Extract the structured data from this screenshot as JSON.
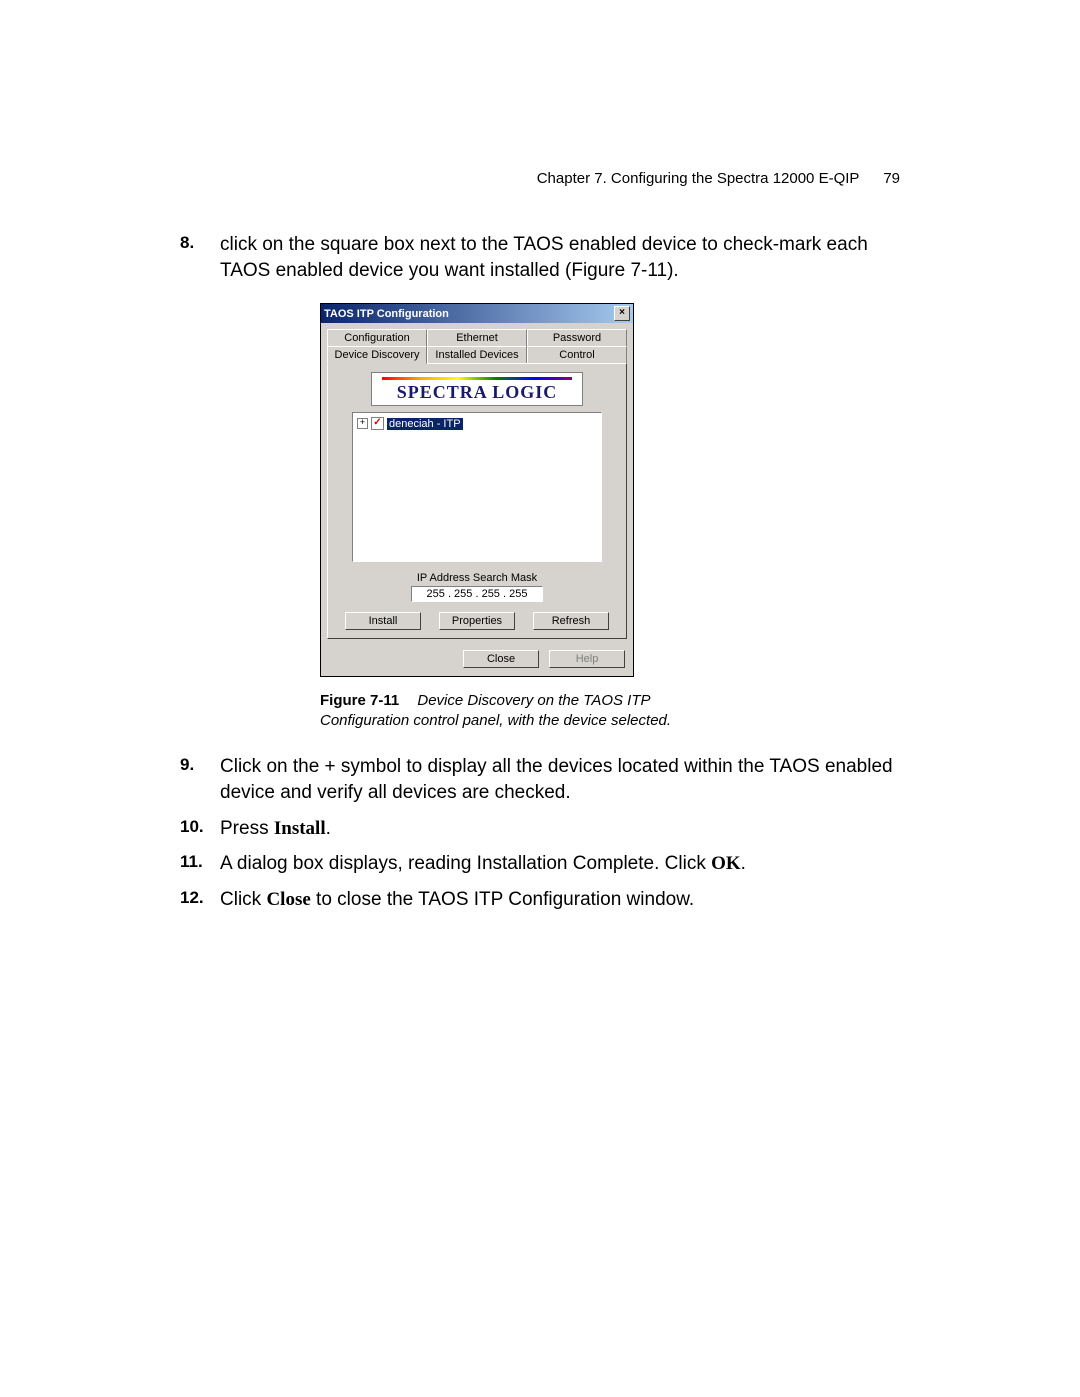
{
  "header": {
    "chapter": "Chapter 7. Configuring the Spectra 12000 E-QIP",
    "page_number": "79"
  },
  "steps": {
    "s8": {
      "num": "8.",
      "text_a": "click on the square box next to the TAOS enabled device to check-mark each TAOS enabled device you want installed (Figure 7-11)."
    },
    "s9": {
      "num": "9.",
      "text_a": "Click on the + symbol to display all the devices located within the TAOS enabled device and verify all devices are checked."
    },
    "s10": {
      "num": "10.",
      "text_a": "Press ",
      "bold": "Install",
      "text_b": "."
    },
    "s11": {
      "num": "11.",
      "text_a": "A dialog box displays, reading Installation Complete. Click ",
      "bold": "OK",
      "text_b": "."
    },
    "s12": {
      "num": "12.",
      "text_a": "Click ",
      "bold": "Close",
      "text_b": " to close the TAOS ITP Configuration window."
    }
  },
  "dialog": {
    "title": "TAOS ITP Configuration",
    "close_x": "×",
    "tabs_row1": [
      "Configuration",
      "Ethernet",
      "Password"
    ],
    "tabs_row2": [
      "Device Discovery",
      "Installed Devices",
      "Control"
    ],
    "logo_text": "SPECTRA LOGIC",
    "tree": {
      "plus": "+",
      "check": "✓",
      "item": "deneciah - ITP"
    },
    "ip_label": "IP Address Search Mask",
    "ip_value": "255  .  255  .  255  .  255",
    "buttons": {
      "install": "Install",
      "properties": "Properties",
      "refresh": "Refresh",
      "close": "Close",
      "help": "Help"
    }
  },
  "caption": {
    "label": "Figure 7-11",
    "text": "Device Discovery on the TAOS ITP Configuration control panel, with the device selected."
  }
}
